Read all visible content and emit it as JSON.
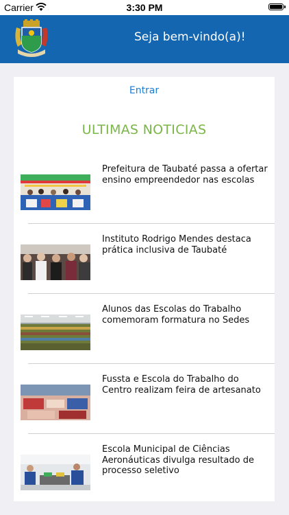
{
  "status_bar": {
    "carrier": "Carrier",
    "time": "3:30 PM"
  },
  "header": {
    "title": "Seja bem-vindo(a)!"
  },
  "login": {
    "label": "Entrar"
  },
  "news_section": {
    "title": "ULTIMAS NOTICIAS"
  },
  "news": [
    {
      "headline": "Prefeitura de Taubaté passa a ofertar ensino empreendedor nas escolas"
    },
    {
      "headline": "Instituto Rodrigo Mendes destaca prática inclusiva de Taubaté"
    },
    {
      "headline": "Alunos das Escolas do Trabalho comemoram formatura no Sedes"
    },
    {
      "headline": "Fussta e Escola do Trabalho do Centro realizam feira de artesanato"
    },
    {
      "headline": "Escola Municipal de Ciências Aeronáuticas divulga resultado de processo seletivo"
    }
  ],
  "colors": {
    "header": "#1566b0",
    "link": "#1a7dd6",
    "section_title": "#7ab648"
  }
}
